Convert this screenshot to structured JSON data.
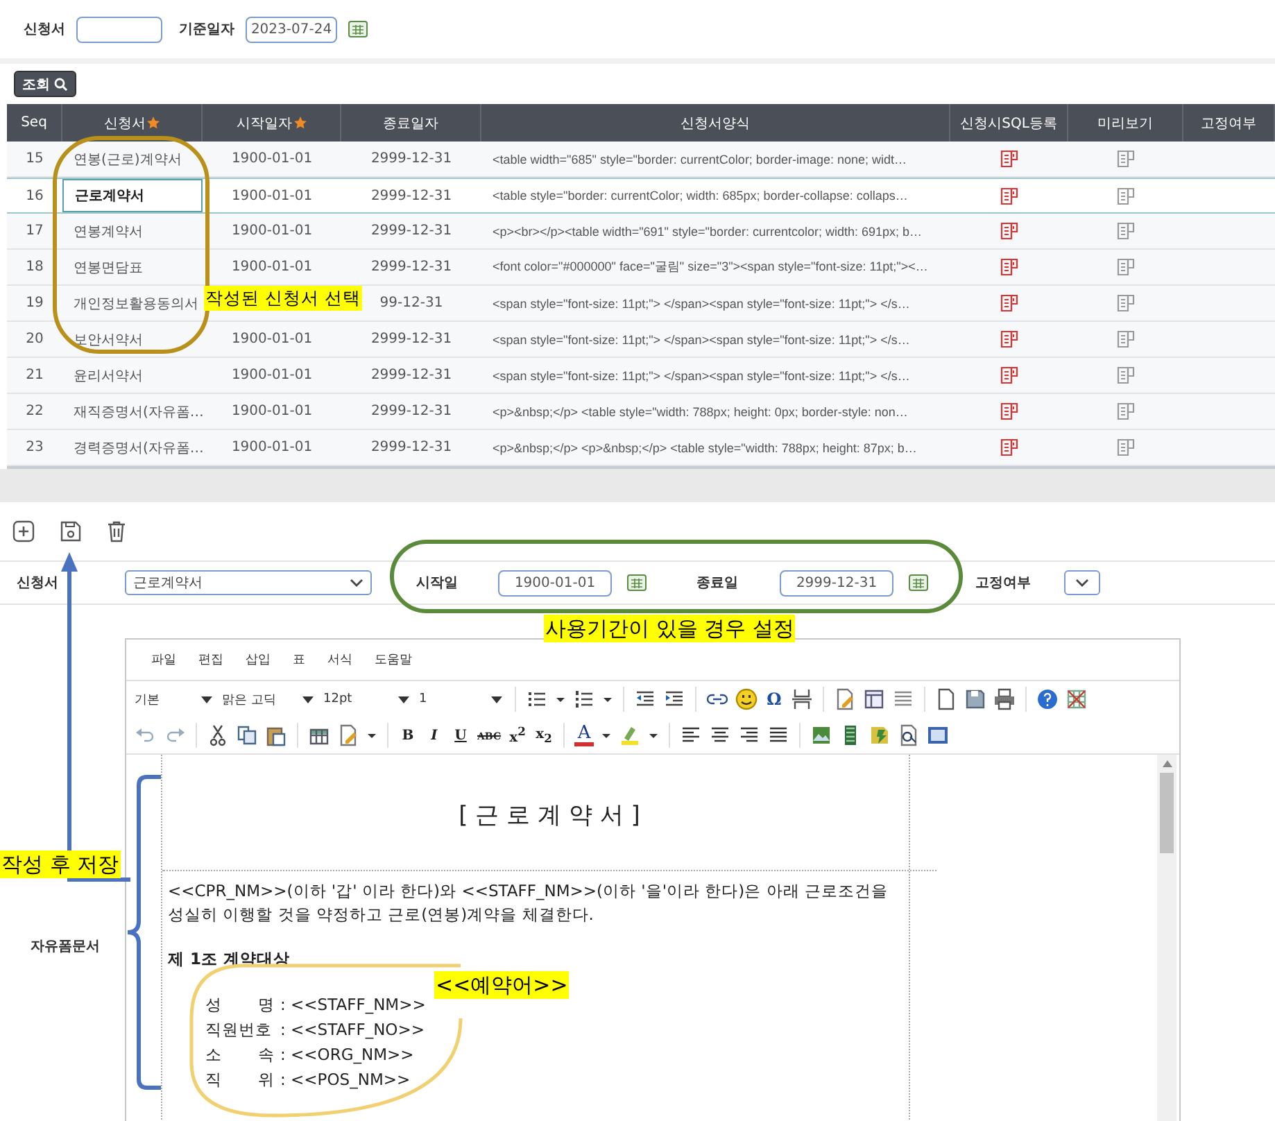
{
  "filter": {
    "form_label": "신청서",
    "date_label": "기준일자",
    "date_value": "2023-07-24"
  },
  "search_button": "조회",
  "table": {
    "columns": [
      {
        "label": "Seq",
        "required": false
      },
      {
        "label": "신청서",
        "required": true
      },
      {
        "label": "시작일자",
        "required": true
      },
      {
        "label": "종료일자",
        "required": false
      },
      {
        "label": "신청서양식",
        "required": false
      },
      {
        "label": "신청시SQL등록",
        "required": false
      },
      {
        "label": "미리보기",
        "required": false
      },
      {
        "label": "고정여부",
        "required": false
      }
    ],
    "rows": [
      {
        "seq": "15",
        "name": "연봉(근로)계약서",
        "start": "1900-01-01",
        "end": "2999-12-31",
        "template": "<table width=\"685\" style=\"border: currentColor; border-image: none; widt…",
        "selected": false
      },
      {
        "seq": "16",
        "name": "근로계약서",
        "start": "1900-01-01",
        "end": "2999-12-31",
        "template": "<table style=\"border: currentColor; width: 685px; border-collapse: collaps…",
        "selected": true
      },
      {
        "seq": "17",
        "name": "연봉계약서",
        "start": "1900-01-01",
        "end": "2999-12-31",
        "template": "<p><br></p><table width=\"691\" style=\"border: currentcolor; width: 691px; b…",
        "selected": false
      },
      {
        "seq": "18",
        "name": "연봉면담표",
        "start": "1900-01-01",
        "end": "2999-12-31",
        "template": "<font color=\"#000000\" face=\"굴림\" size=\"3\"><span style=\"font-size: 11pt;\"><…",
        "selected": false
      },
      {
        "seq": "19",
        "name": "개인정보활용동의서",
        "end": "99-12-31",
        "template": "<span style=\"font-size: 11pt;\"> </span><span style=\"font-size: 11pt;\"> </s…",
        "selected": false
      },
      {
        "seq": "20",
        "name": "보안서약서",
        "start": "1900-01-01",
        "end": "2999-12-31",
        "template": "<span style=\"font-size: 11pt;\"> </span><span style=\"font-size: 11pt;\"> </s…",
        "selected": false
      },
      {
        "seq": "21",
        "name": "윤리서약서",
        "start": "1900-01-01",
        "end": "2999-12-31",
        "template": "<span style=\"font-size: 11pt;\"> </span><span style=\"font-size: 11pt;\"> </s…",
        "selected": false
      },
      {
        "seq": "22",
        "name": "재직증명서(자유폼…",
        "start": "1900-01-01",
        "end": "2999-12-31",
        "template": "<p>&nbsp;</p> <table style=\"width: 788px; height: 0px; border-style: non…",
        "selected": false
      },
      {
        "seq": "23",
        "name": "경력증명서(자유폼…",
        "start": "1900-01-01",
        "end": "2999-12-31",
        "template": "<p>&nbsp;</p> <p>&nbsp;</p> <table style=\"width: 788px; height: 87px; b…",
        "selected": false
      }
    ]
  },
  "form": {
    "form_label": "신청서",
    "form_value": "근로계약서",
    "start_label": "시작일",
    "start_value": "1900-01-01",
    "end_label": "종료일",
    "end_value": "2999-12-31",
    "fixed_label": "고정여부",
    "editor_label": "자유폼문서"
  },
  "editor": {
    "menu": [
      "파일",
      "편집",
      "삽입",
      "표",
      "서식",
      "도움말"
    ],
    "toolbar_rows": [
      [
        {
          "kind": "select",
          "label": "기본"
        },
        {
          "kind": "select",
          "label": "맑은 고딕"
        },
        {
          "kind": "select",
          "label": "12pt"
        },
        {
          "kind": "select",
          "label": "1"
        },
        {
          "kind": "sep"
        },
        {
          "kind": "icon"
        },
        {
          "kind": "icon"
        },
        {
          "kind": "icon"
        },
        {
          "kind": "icon"
        },
        {
          "kind": "sep"
        },
        {
          "kind": "icon"
        },
        {
          "kind": "icon"
        },
        {
          "kind": "sep"
        },
        {
          "kind": "icon"
        },
        {
          "kind": "icon"
        },
        {
          "kind": "glyph",
          "text": "Ω"
        },
        {
          "kind": "icon"
        },
        {
          "kind": "sep"
        },
        {
          "kind": "icon"
        },
        {
          "kind": "icon"
        },
        {
          "kind": "icon"
        },
        {
          "kind": "sep"
        },
        {
          "kind": "icon"
        },
        {
          "kind": "icon"
        },
        {
          "kind": "icon"
        },
        {
          "kind": "sep"
        },
        {
          "kind": "icon"
        },
        {
          "kind": "icon"
        }
      ],
      [
        {
          "kind": "icon"
        },
        {
          "kind": "icon"
        },
        {
          "kind": "sep"
        },
        {
          "kind": "icon"
        },
        {
          "kind": "icon"
        },
        {
          "kind": "icon"
        },
        {
          "kind": "sep"
        },
        {
          "kind": "icon"
        },
        {
          "kind": "icon"
        },
        {
          "kind": "icon"
        },
        {
          "kind": "sep"
        },
        {
          "kind": "glyph",
          "text": "B"
        },
        {
          "kind": "glyph",
          "text": "I"
        },
        {
          "kind": "glyph",
          "text": "U"
        },
        {
          "kind": "glyph",
          "text": "ABC"
        },
        {
          "kind": "glyph",
          "text": "x$^{2}$"
        },
        {
          "kind": "glyph",
          "text": "x$_{2}$"
        },
        {
          "kind": "sep"
        },
        {
          "kind": "glyph",
          "text": "A"
        },
        {
          "kind": "icon"
        },
        {
          "kind": "icon"
        },
        {
          "kind": "icon"
        },
        {
          "kind": "sep"
        },
        {
          "kind": "icon"
        },
        {
          "kind": "icon"
        },
        {
          "kind": "icon"
        },
        {
          "kind": "icon"
        },
        {
          "kind": "sep"
        },
        {
          "kind": "icon"
        },
        {
          "kind": "icon"
        },
        {
          "kind": "icon"
        },
        {
          "kind": "icon"
        },
        {
          "kind": "icon"
        }
      ]
    ],
    "doc_title": "[ 근 로 계 약 서 ]",
    "paragraph": "<<CPR_NM>>(이하 '갑' 이라 한다)와 <<STAFF_NM>>(이하 '을'이라 한다)은 아래 근로조건을 성실히 이행할 것을 약정하고 근로(연봉)계약을 체결한다.",
    "heading": "제 1조 계약대상",
    "fields": [
      {
        "label": "성 명",
        "value": ": <<STAFF_NM>>"
      },
      {
        "label": "직원번호",
        "value": ": <<STAFF_NO>>"
      },
      {
        "label": "소 속",
        "value": ": <<ORG_NM>>"
      },
      {
        "label": "직 위",
        "value": ": <<POS_NM>>"
      }
    ]
  },
  "annotations": [
    {
      "text": "작성된 신청서 선택"
    },
    {
      "text": "사용기간이 있을 경우 설정"
    },
    {
      "text": "작성 후 저장"
    },
    {
      "text": "<<예약어>>"
    }
  ]
}
